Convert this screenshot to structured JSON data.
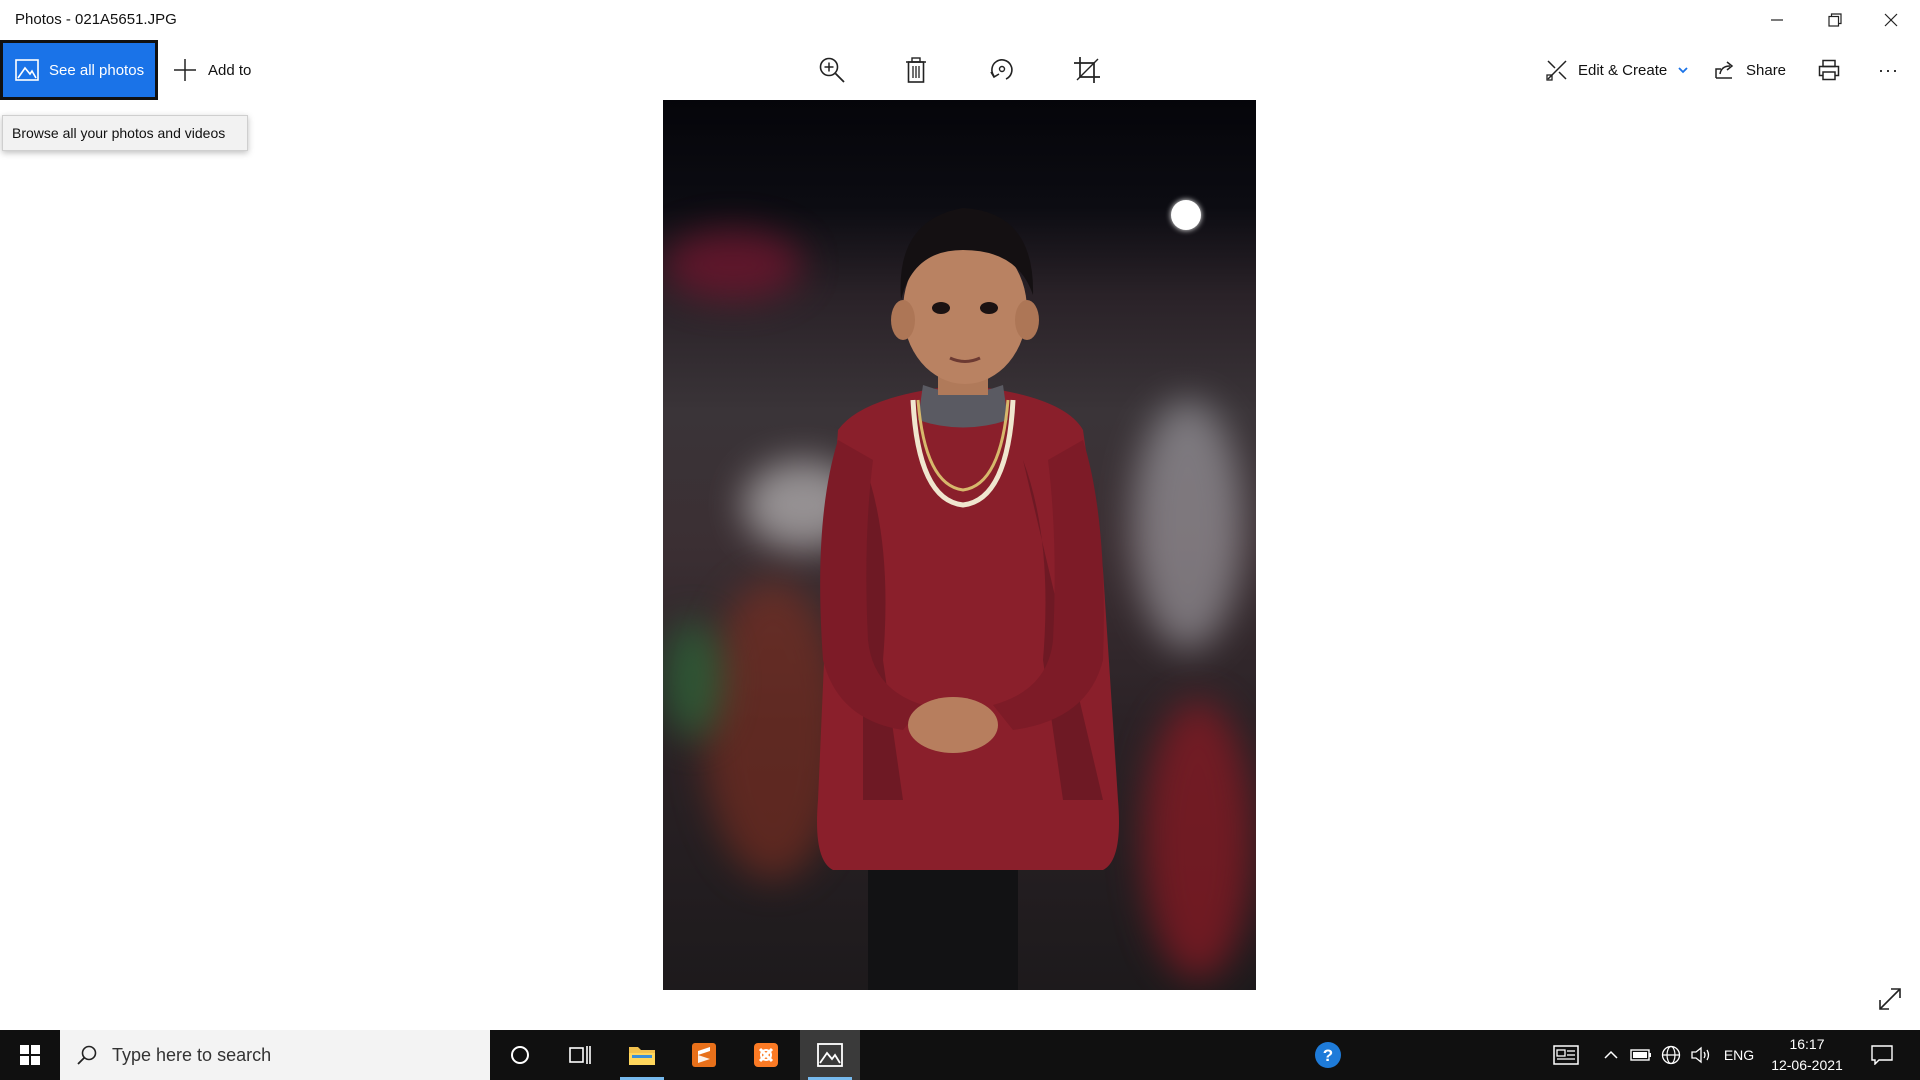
{
  "window": {
    "title": "Photos - 021A5651.JPG"
  },
  "toolbar": {
    "see_all_label": "See all photos",
    "add_to_label": "Add to",
    "edit_create_label": "Edit & Create",
    "share_label": "Share",
    "more_label": "···"
  },
  "tooltip": {
    "text": "Browse all your photos and videos"
  },
  "taskbar": {
    "search_placeholder": "Type here to search",
    "language": "ENG",
    "time": "16:17",
    "date": "12-06-2021"
  },
  "colors": {
    "accent": "#1a73e8",
    "taskbar": "#101010",
    "active_underline": "#76b9ed"
  }
}
